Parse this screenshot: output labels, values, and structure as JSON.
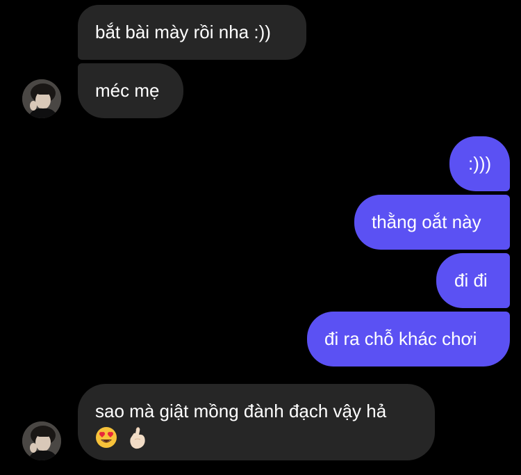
{
  "messages": [
    {
      "sender": "contact",
      "text": "bắt bài mày rồi nha :))"
    },
    {
      "sender": "contact",
      "text": "méc mẹ"
    },
    {
      "sender": "me",
      "text": ":)))"
    },
    {
      "sender": "me",
      "text": "thằng oắt này"
    },
    {
      "sender": "me",
      "text": "đi đi"
    },
    {
      "sender": "me",
      "text": "đi ra chỗ khác chơi"
    },
    {
      "sender": "contact",
      "text": "sao mà giật mồng đành đạch vậy hả",
      "emojis": [
        "heart-eyes-face",
        "pinched-fingers"
      ]
    }
  ],
  "colors": {
    "background": "#000000",
    "incoming_bubble": "#262626",
    "outgoing_bubble": "#5b51f3",
    "text": "#ffffff"
  },
  "icons": {
    "avatar": "contact-avatar-photo",
    "emoji_1": "heart-eyes-emoji",
    "emoji_2": "hand-gesture-emoji"
  }
}
